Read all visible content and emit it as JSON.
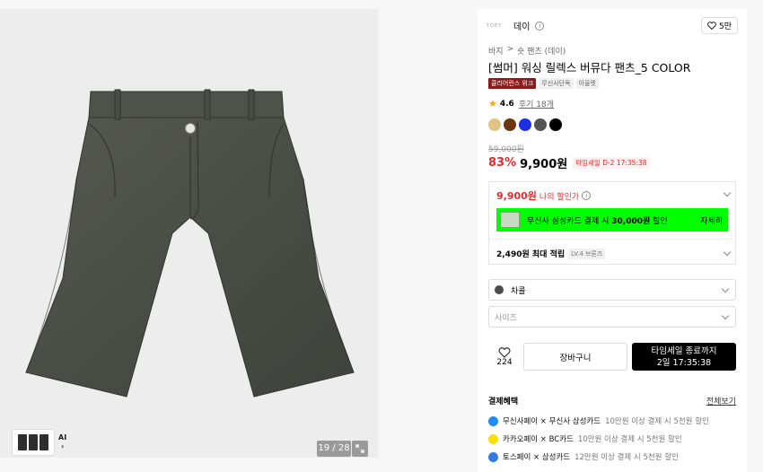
{
  "gallery": {
    "counter": "19 / 28",
    "ai_label": "AI",
    "ai_chevron": "›",
    "product_color": "#4a4c46"
  },
  "brand": {
    "logo_text": "TOEY",
    "name": "데이",
    "info_icon": "i"
  },
  "like": {
    "icon": "heart-icon",
    "count": "5만"
  },
  "breadcrumb": {
    "items": [
      "바지",
      ">",
      "숏 팬츠 (데이)"
    ]
  },
  "product": {
    "title": "[썸머] 워싱 릴렉스 버뮤다 팬츠_5 COLOR",
    "tags": [
      "클리어런스 위크",
      "무신사단독",
      "아울렛"
    ],
    "rating": "4.6",
    "reviews": "후기 18개",
    "swatches": [
      "#e2c385",
      "#6b3510",
      "#1a2fe6",
      "#555555",
      "#000000"
    ],
    "original_price": "59,000원",
    "discount": "83%",
    "price": "9,900원",
    "timesale": "타임세일 D-2 17:35:38"
  },
  "benefits": {
    "my_price": "9,900원",
    "my_price_label": "나의 할인가",
    "card_banner_prefix": "무신사 삼성카드 결제 시 ",
    "card_banner_amount": "30,000원",
    "card_banner_suffix": " 할인",
    "card_detail": "자세히",
    "points": "2,490원 최대 적립",
    "level": "LV.4 브론즈",
    "highlight_color": "#00ff00"
  },
  "options": {
    "color_value": "차콜",
    "size_placeholder": "사이즈"
  },
  "actions": {
    "wish_count": "224",
    "cart_label": "장바구니",
    "buy_line1": "타임세일 종료까지",
    "buy_line2": "2일 17:35:38"
  },
  "payment": {
    "heading": "결제혜택",
    "view_all": "전체보기",
    "rows": [
      {
        "title": "무신사페이 × 무신사 삼성카드",
        "detail": "10만원 이상 결제 시 5천원 할인",
        "icon_color": "#1e8cf0"
      },
      {
        "title": "카카오페이 × BC카드",
        "detail": "10만원 이상 결제 시 5천원 할인",
        "icon_color": "#f7e00b"
      },
      {
        "title": "토스페이 × 삼성카드",
        "detail": "12만원 이상 결제 시 5천원 할인",
        "icon_color": "#2f7de1"
      }
    ]
  }
}
